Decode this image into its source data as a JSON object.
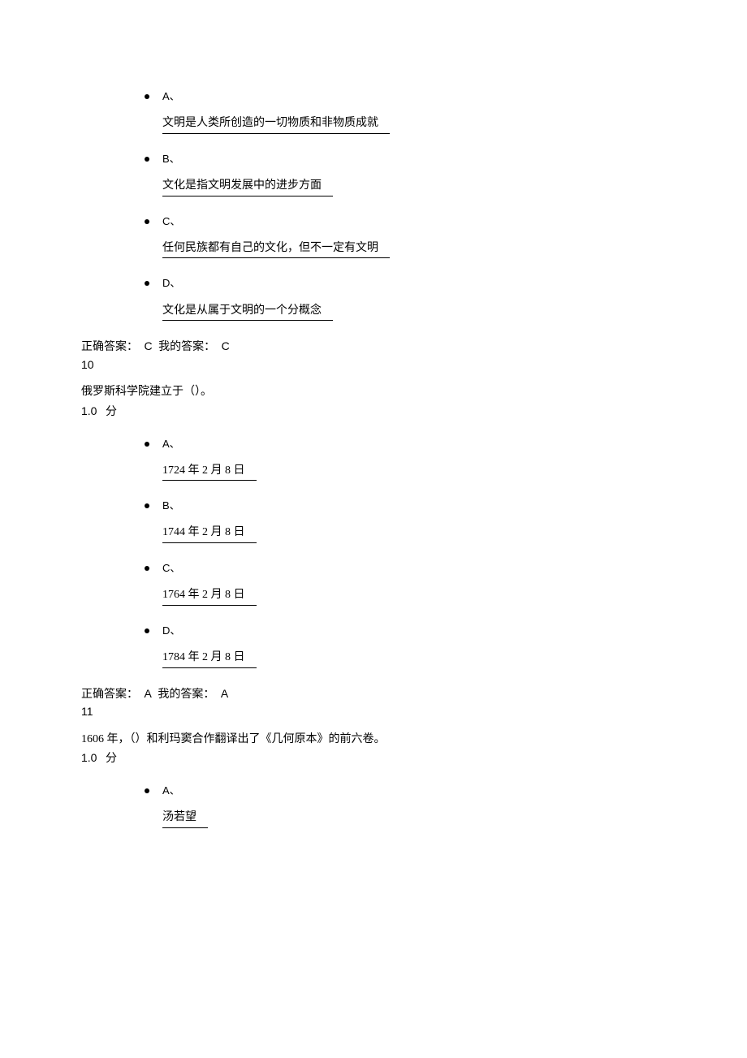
{
  "q9": {
    "options": [
      {
        "letter": "A、",
        "text": "文明是人类所创造的一切物质和非物质成就"
      },
      {
        "letter": "B、",
        "text": "文化是指文明发展中的进步方面"
      },
      {
        "letter": "C、",
        "text": "任何民族都有自己的文化，但不一定有文明"
      },
      {
        "letter": "D、",
        "text": "文化是从属于文明的一个分概念"
      }
    ],
    "correct_label": "正确答案：",
    "correct_value": "C",
    "my_label": "我的答案：",
    "my_value": "C"
  },
  "q10": {
    "number": "10",
    "stem": "俄罗斯科学院建立于（）。",
    "score_num": "1.0",
    "score_unit": "分",
    "options": [
      {
        "letter": "A、",
        "text": "1724 年 2 月 8 日"
      },
      {
        "letter": "B、",
        "text": "1744 年 2 月 8 日"
      },
      {
        "letter": "C、",
        "text": "1764 年 2 月 8 日"
      },
      {
        "letter": "D、",
        "text": "1784 年 2 月 8 日"
      }
    ],
    "correct_label": "正确答案：",
    "correct_value": "A",
    "my_label": "我的答案：",
    "my_value": "A"
  },
  "q11": {
    "number": "11",
    "stem": "1606 年，（）和利玛窦合作翻译出了《几何原本》的前六卷。",
    "score_num": "1.0",
    "score_unit": "分",
    "options": [
      {
        "letter": "A、",
        "text": "汤若望"
      }
    ]
  }
}
